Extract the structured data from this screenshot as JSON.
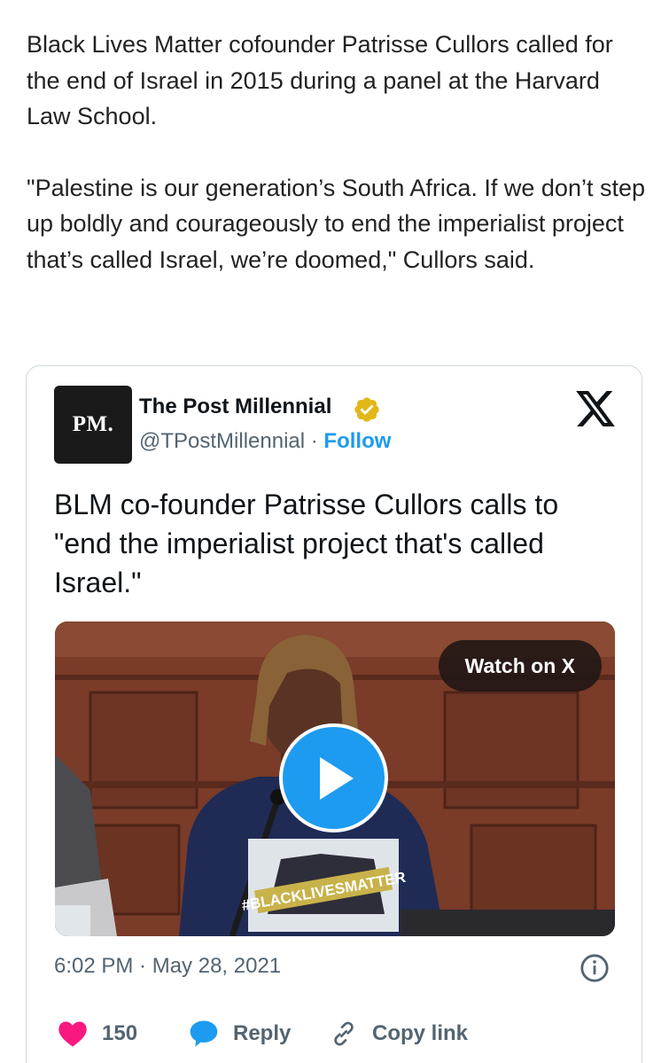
{
  "article": {
    "paragraph1": "Black Lives Matter cofounder Patrisse Cullors called for the end of Israel in 2015 during a panel at the Harvard Law School.",
    "paragraph2": "\"Palestine is our generation’s South Africa. If we don’t step up boldly and courageously to end the imperialist project that’s called Israel, we’re doomed,\" Cullors said."
  },
  "tweet": {
    "avatar_text": "PM.",
    "author_name": "The Post Millennial",
    "handle": "@TPostMillennial",
    "separator": " · ",
    "follow_label": "Follow",
    "text": "BLM co-founder Patrisse Cullors calls to \"end the imperialist project that's called Israel.\"",
    "media": {
      "watch_label": "Watch on X",
      "shirt_text": "#BLACKLIVESMATTER"
    },
    "timestamp": "6:02 PM · May 28, 2021",
    "likes": "150",
    "reply_label": "Reply",
    "copy_link_label": "Copy link"
  },
  "colors": {
    "accent": "#1d9bf0",
    "like": "#f91880",
    "verified_gold": "#e2b719",
    "muted_text": "#536471"
  },
  "icons": [
    "verified-badge-icon",
    "x-logo-icon",
    "play-icon",
    "info-icon",
    "heart-icon",
    "reply-bubble-icon",
    "link-icon"
  ]
}
